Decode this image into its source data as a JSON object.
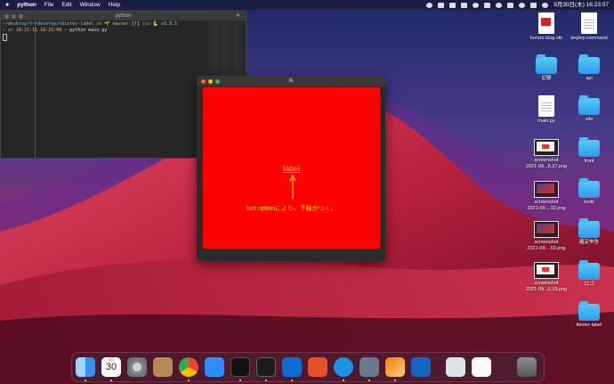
{
  "menubar": {
    "app": "python",
    "items": [
      "File",
      "Edit",
      "Window",
      "Help"
    ],
    "clock": "9月30日(木) 16:23:07"
  },
  "terminal": {
    "title": "python",
    "close_glyph": "✕",
    "lines": [
      {
        "path": "~/desktop/f",
        "tail": "~/desktop/tkinter-label",
        "on": " on ",
        "branch_icon": "🌱",
        "branch": " master",
        "status": " [?]",
        "via": " via ",
        "py_icon": "🐍",
        "ver": " v3.8.5"
      },
      {
        "at": "» at ",
        "time": "16:21:11",
        "time2": "16:21:09",
        "prompt": " › ",
        "cmd": "python main.py"
      }
    ]
  },
  "tk": {
    "title": "tk",
    "label": "label",
    "annotation": "font optionにより、下線がつく。",
    "colors": {
      "canvas": "#ff0000",
      "text": "#ffd700"
    }
  },
  "desktop": {
    "icons": [
      {
        "name": "kuroro.blog.stk",
        "kind": "doc-red"
      },
      {
        "name": "deploy.command",
        "kind": "doc"
      },
      {
        "name": "記録",
        "kind": "folder"
      },
      {
        "name": "api",
        "kind": "folder"
      },
      {
        "name": "main.py",
        "kind": "doc"
      },
      {
        "name": "site",
        "kind": "folder"
      },
      {
        "name": "screenshot\n2021-09...8.37.png",
        "kind": "shot-light"
      },
      {
        "name": "front",
        "kind": "folder"
      },
      {
        "name": "screenshot\n2021-09....32.png",
        "kind": "shot-dark"
      },
      {
        "name": "tools",
        "kind": "folder"
      },
      {
        "name": "screenshot\n2021-09....50.png",
        "kind": "shot-dark"
      },
      {
        "name": "確定申告",
        "kind": "folder"
      },
      {
        "name": "screenshot\n2021-09...0.19.png",
        "kind": "shot-light"
      },
      {
        "name": "ロゴ",
        "kind": "folder"
      },
      {
        "name": "tkinter-label",
        "kind": "folder"
      }
    ]
  },
  "dock": {
    "calendar_month": "9月",
    "calendar_day": "30",
    "apps": [
      "finder-icon",
      "calendar-icon",
      "system-preferences-icon",
      "contacts-icon",
      "chrome-icon",
      "zoom-icon",
      "iterm-icon",
      "terminal-icon",
      "vscode-icon",
      "tableplus-icon",
      "docker-icon",
      "preview-icon",
      "monitor-icon",
      "infinity-icon",
      "finder-window-icon",
      "document-icon",
      "trash-icon"
    ]
  }
}
